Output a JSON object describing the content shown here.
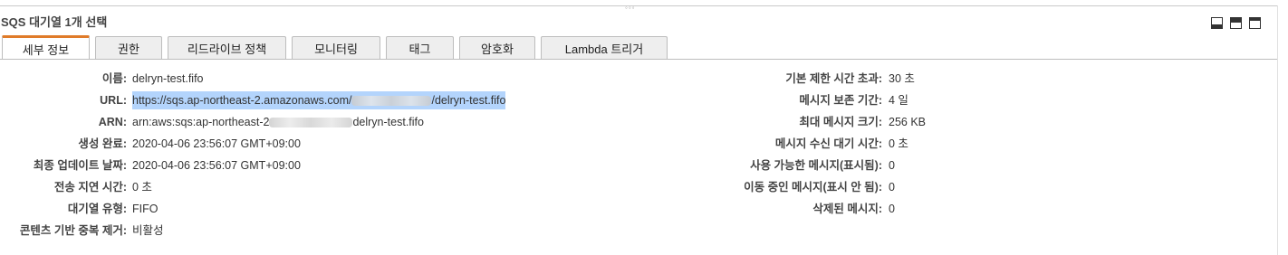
{
  "panel": {
    "title": "SQS 대기열 1개 선택",
    "grip": "◦◦◦"
  },
  "tabs": [
    {
      "label": "세부 정보",
      "active": true
    },
    {
      "label": "권한"
    },
    {
      "label": "리드라이브 정책"
    },
    {
      "label": "모니터링"
    },
    {
      "label": "태그"
    },
    {
      "label": "암호화"
    },
    {
      "label": "Lambda 트리거"
    }
  ],
  "details_left": {
    "name": {
      "label": "이름:",
      "value": "delryn-test.fifo"
    },
    "url": {
      "label": "URL:",
      "prefix": "https://sqs.ap-northeast-2.amazonaws.com/",
      "suffix": "/delryn-test.fifo"
    },
    "arn": {
      "label": "ARN:",
      "prefix": "arn:aws:sqs:ap-northeast-2",
      "suffix": "delryn-test.fifo"
    },
    "created": {
      "label": "생성 완료:",
      "value": "2020-04-06 23:56:07 GMT+09:00"
    },
    "updated": {
      "label": "최종 업데이트 날짜:",
      "value": "2020-04-06 23:56:07 GMT+09:00"
    },
    "delay": {
      "label": "전송 지연 시간:",
      "value": "0 초"
    },
    "queue_type": {
      "label": "대기열 유형:",
      "value": "FIFO"
    },
    "dedup": {
      "label": "콘텐츠 기반 중복 제거:",
      "value": "비활성"
    }
  },
  "details_right": {
    "visibility_timeout": {
      "label": "기본 제한 시간 초과:",
      "value": "30 초"
    },
    "retention": {
      "label": "메시지 보존 기간:",
      "value": "4 일"
    },
    "max_size": {
      "label": "최대 메시지 크기:",
      "value": "256 KB"
    },
    "receive_wait": {
      "label": "메시지 수신 대기 시간:",
      "value": "0 초"
    },
    "available": {
      "label": "사용 가능한 메시지(표시됨):",
      "value": "0"
    },
    "in_flight": {
      "label": "이동 중인 메시지(표시 안 됨):",
      "value": "0"
    },
    "deleted": {
      "label": "삭제된 메시지:",
      "value": "0"
    }
  },
  "colors": {
    "active_tab_accent": "#e07b29",
    "url_highlight": "#b3d4fc"
  }
}
